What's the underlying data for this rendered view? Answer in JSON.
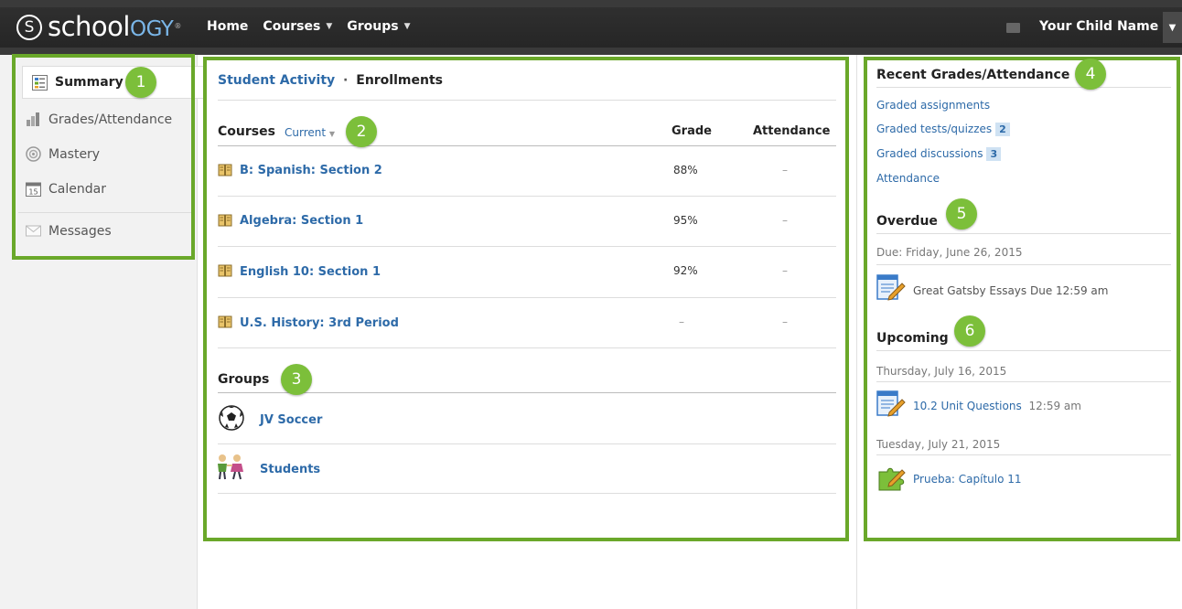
{
  "header": {
    "logo_s": "S",
    "logo_text": "school",
    "logo_text_accent": "OGY",
    "logo_tm": "®",
    "nav": [
      {
        "label": "Home"
      },
      {
        "label": "Courses"
      },
      {
        "label": "Groups"
      }
    ],
    "user_name": "Your Child Name"
  },
  "sidebar": {
    "items": [
      {
        "label": "Summary"
      },
      {
        "label": "Grades/Attendance"
      },
      {
        "label": "Mastery"
      },
      {
        "label": "Calendar",
        "icon_number": "15"
      },
      {
        "label": "Messages"
      }
    ]
  },
  "badges": [
    "1",
    "2",
    "3",
    "4",
    "5",
    "6"
  ],
  "main": {
    "breadcrumb_link": "Student Activity",
    "breadcrumb_sep": "·",
    "breadcrumb_current": "Enrollments",
    "courses_heading": "Courses",
    "courses_filter": "Current",
    "columns": {
      "grade": "Grade",
      "attendance": "Attendance"
    },
    "courses": [
      {
        "name": "B: Spanish: Section 2",
        "grade": "88%",
        "attendance": "–"
      },
      {
        "name": "Algebra: Section 1",
        "grade": "95%",
        "attendance": "–"
      },
      {
        "name": "English 10: Section 1",
        "grade": "92%",
        "attendance": "–"
      },
      {
        "name": "U.S. History: 3rd Period",
        "grade": "–",
        "attendance": "–"
      }
    ],
    "groups_heading": "Groups",
    "groups": [
      {
        "name": "JV Soccer"
      },
      {
        "name": "Students"
      }
    ]
  },
  "right": {
    "recent_heading": "Recent Grades/Attendance",
    "recent_links": [
      {
        "label": "Graded assignments",
        "count": ""
      },
      {
        "label": "Graded tests/quizzes",
        "count": "2"
      },
      {
        "label": "Graded discussions",
        "count": "3"
      },
      {
        "label": "Attendance",
        "count": ""
      }
    ],
    "overdue_heading": "Overdue",
    "overdue_date": "Due: Friday, June 26, 2015",
    "overdue_item": "Great Gatsby Essays Due 12:59 am",
    "upcoming_heading": "Upcoming",
    "upcoming": [
      {
        "date": "Thursday, July 16, 2015",
        "title": "10.2 Unit Questions",
        "time": "12:59 am"
      },
      {
        "date": "Tuesday, July 21, 2015",
        "title": "Prueba: Capítulo 11",
        "time": ""
      }
    ]
  },
  "colors": {
    "topbar": "#262626",
    "link": "#2d6aa8",
    "annotation_green": "#6aa82a",
    "badge_green": "#7cbf3a"
  }
}
